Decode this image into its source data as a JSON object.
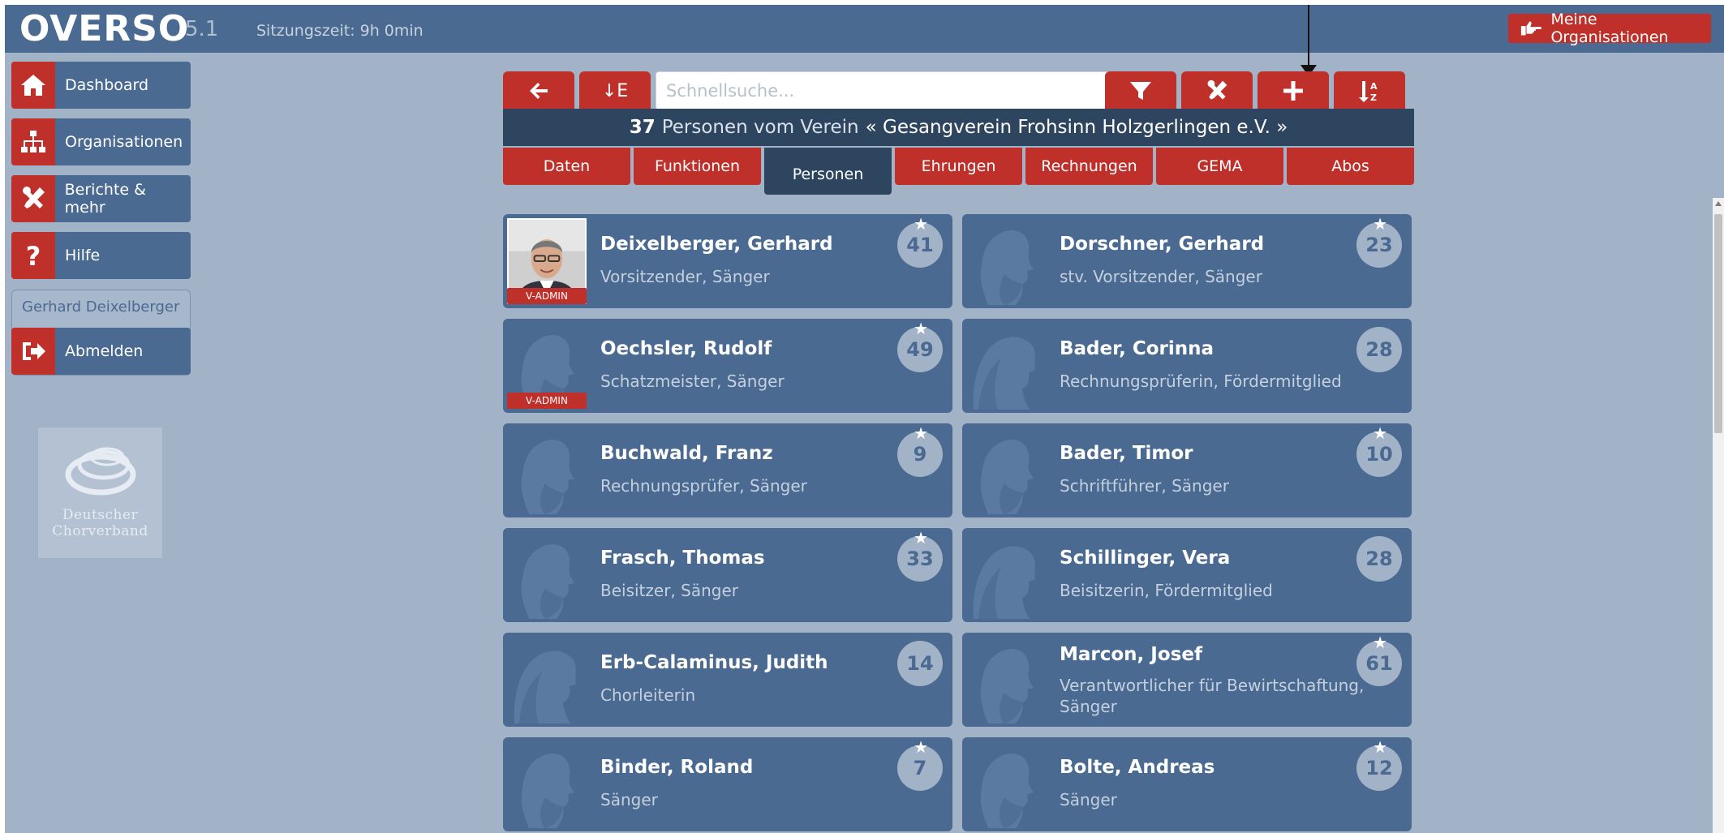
{
  "header": {
    "logo": "OVERSO",
    "version": "5.1",
    "session": "Sitzungszeit: 9h 0min",
    "org_button": "Meine Organisationen"
  },
  "sidebar": {
    "items": [
      {
        "label": "Dashboard",
        "icon": "home-icon"
      },
      {
        "label": "Organisationen",
        "icon": "org-chart-icon"
      },
      {
        "label": "Berichte & mehr",
        "icon": "tools-icon"
      },
      {
        "label": "Hilfe",
        "icon": "question-icon"
      }
    ],
    "user_name": "Gerhard Deixelberger",
    "logout_label": "Abmelden",
    "partner_logo_line1": "Deutscher",
    "partner_logo_line2": "Chorverband"
  },
  "toolbar": {
    "sort_e_label": "↓E",
    "search_placeholder": "Schnellsuche..."
  },
  "info": {
    "count": "37",
    "text": "Personen vom Verein",
    "club": "« Gesangverein Frohsinn Holzgerlingen e.V. »"
  },
  "tabs": [
    "Daten",
    "Funktionen",
    "Personen",
    "Ehrungen",
    "Rechnungen",
    "GEMA",
    "Abos"
  ],
  "active_tab": "Personen",
  "persons": [
    {
      "name": "Deixelberger, Gerhard",
      "role": "Vorsitzender, Sänger",
      "years": "41",
      "star": true,
      "badge": "V-ADMIN",
      "avatar": "photo"
    },
    {
      "name": "Dorschner, Gerhard",
      "role": "stv. Vorsitzender, Sänger",
      "years": "23",
      "star": true,
      "badge": "",
      "avatar": "male"
    },
    {
      "name": "Oechsler, Rudolf",
      "role": "Schatzmeister, Sänger",
      "years": "49",
      "star": true,
      "badge": "V-ADMIN",
      "avatar": "male"
    },
    {
      "name": "Bader, Corinna",
      "role": "Rechnungsprüferin, Fördermitglied",
      "years": "28",
      "star": false,
      "badge": "",
      "avatar": "female"
    },
    {
      "name": "Buchwald, Franz",
      "role": "Rechnungsprüfer, Sänger",
      "years": "9",
      "star": true,
      "badge": "",
      "avatar": "male"
    },
    {
      "name": "Bader, Timor",
      "role": "Schriftführer, Sänger",
      "years": "10",
      "star": true,
      "badge": "",
      "avatar": "male"
    },
    {
      "name": "Frasch, Thomas",
      "role": "Beisitzer, Sänger",
      "years": "33",
      "star": true,
      "badge": "",
      "avatar": "male"
    },
    {
      "name": "Schillinger, Vera",
      "role": "Beisitzerin, Fördermitglied",
      "years": "28",
      "star": false,
      "badge": "",
      "avatar": "female"
    },
    {
      "name": "Erb-Calaminus, Judith",
      "role": "Chorleiterin",
      "years": "14",
      "star": false,
      "badge": "",
      "avatar": "female"
    },
    {
      "name": "Marcon, Josef",
      "role": "Verantwortlicher für Bewirtschaftung, Sänger",
      "years": "61",
      "star": true,
      "badge": "",
      "avatar": "male"
    },
    {
      "name": "Binder, Roland",
      "role": "Sänger",
      "years": "7",
      "star": true,
      "badge": "",
      "avatar": "male"
    },
    {
      "name": "Bolte, Andreas",
      "role": "Sänger",
      "years": "12",
      "star": true,
      "badge": "",
      "avatar": "male"
    }
  ]
}
